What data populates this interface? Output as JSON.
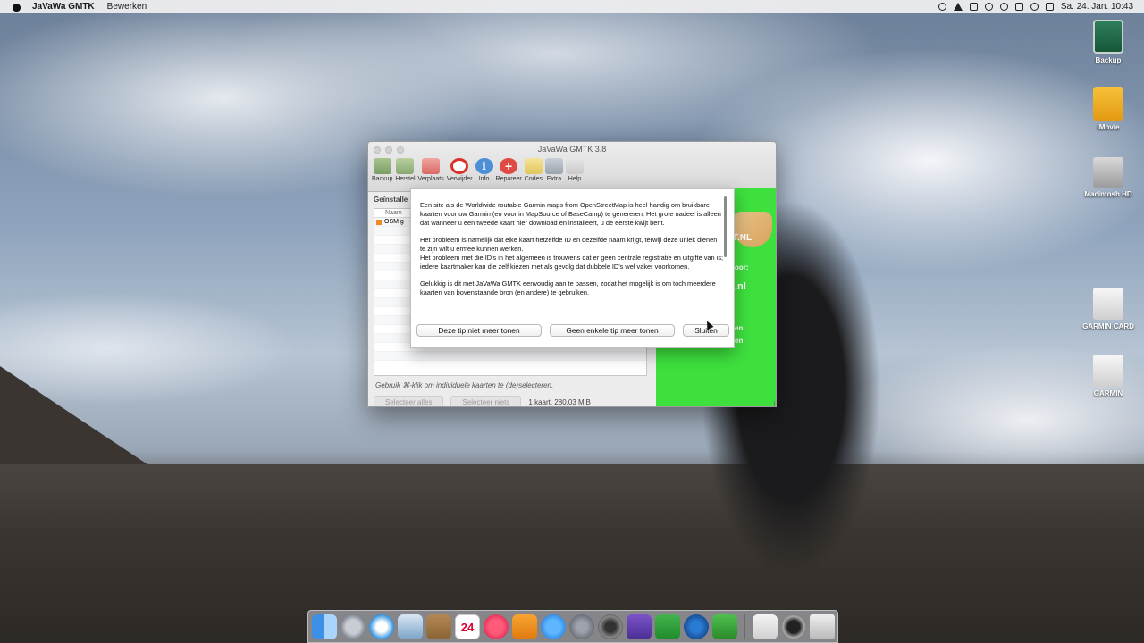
{
  "menubar": {
    "app_name": "JaVaWa GMTK",
    "menus": [
      "Bewerken"
    ],
    "clock": "Sa. 24. Jan.  10:43"
  },
  "desktop_icons": [
    {
      "label": "Backup",
      "icon": "time-machine-drive-icon"
    },
    {
      "label": "iMovie",
      "icon": "folder-icon"
    },
    {
      "label": "Macintosh HD",
      "icon": "hard-drive-icon"
    },
    {
      "label": "GARMIN CARD",
      "icon": "removable-drive-icon"
    },
    {
      "label": "GARMIN",
      "icon": "removable-drive-icon"
    }
  ],
  "window": {
    "title": "JaVaWa GMTK 3.8",
    "toolbar": [
      {
        "label": "Backup",
        "icon": "backup-icon"
      },
      {
        "label": "Herstel",
        "icon": "restore-icon"
      },
      {
        "label": "Verplaats",
        "icon": "move-icon"
      },
      {
        "label": "Verwijder",
        "icon": "delete-icon"
      },
      {
        "label": "Info",
        "icon": "info-icon"
      },
      {
        "label": "Repareer",
        "icon": "repair-icon"
      },
      {
        "label": "Codes",
        "icon": "codes-icon"
      },
      {
        "label": "Extra",
        "icon": "extra-icon"
      },
      {
        "label": "Help",
        "icon": "help-icon"
      }
    ],
    "installed_label": "Geïnstalle",
    "list": {
      "header": "Naam",
      "rows": [
        {
          "name": "OSM g",
          "checked": true
        }
      ]
    },
    "hint": "Gebruik ⌘-klik om individuele kaarten te (de)selecteren.",
    "select_all": "Selecteer alles",
    "select_none": "Selecteer niets",
    "size_info": "1 kaart, 280,03 MiB",
    "side_panel": {
      "logo_text": "T.NL",
      "texts": [
        "oor:",
        ".nl",
        "en",
        "en"
      ]
    }
  },
  "tip": {
    "paragraphs": [
      "Een site als de Worldwide routable Garmin maps from OpenStreetMap is heel handig om bruikbare kaarten voor uw Garmin (en voor in MapSource of BaseCamp) te genereren. Het grote nadeel is alleen dat wanneer u een tweede kaart hier download en installeert, u de eerste kwijt bent.",
      "Het probleem is namelijk dat elke kaart hetzelfde ID en dezelfde naam krijgt, terwijl deze uniek dienen te zijn wilt u ermee kunnen werken.\nHet probleem met die ID's in het algemeen is trouwens dat er geen centrale registratie en uitgifte van is; iedere kaartmaker kan die zelf kiezen met als gevolg dat dubbele ID's wel vaker voorkomen.",
      "Gelukkig is dit met JaVaWa GMTK eenvoudig aan te passen, zodat het mogelijk is om toch meerdere kaarten van bovenstaande bron (en andere) te gebruiken."
    ],
    "buttons": {
      "dont_show_this": "Deze tip niet meer tonen",
      "dont_show_any": "Geen enkele tip meer tonen",
      "close": "Sluiten"
    }
  },
  "dock": {
    "calendar_day": "24",
    "items": [
      "finder-icon",
      "launchpad-icon",
      "safari-icon",
      "preview-icon",
      "contacts-icon",
      "calendar-icon",
      "itunes-icon",
      "ibooks-icon",
      "app-store-icon",
      "system-preferences-icon",
      "photo-booth-icon",
      "imovie-icon",
      "numbers-icon",
      "quicktime-icon",
      "javawa-gmtk-icon",
      "preview-document-icon",
      "camera-icon",
      "trash-icon"
    ]
  }
}
